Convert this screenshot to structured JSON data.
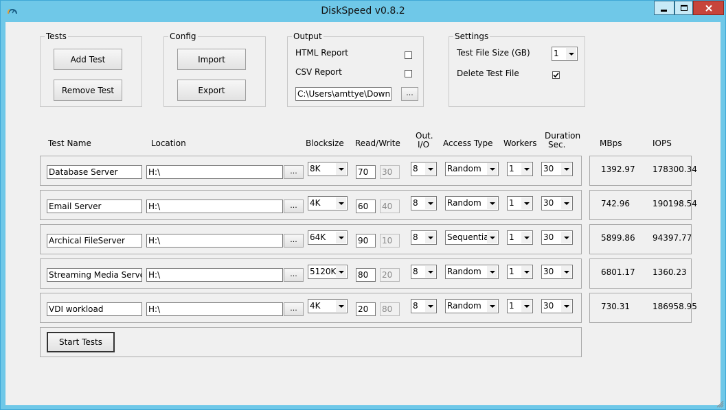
{
  "window": {
    "title": "DiskSpeed v0.8.2"
  },
  "groups": {
    "tests": {
      "legend": "Tests",
      "add_label": "Add Test",
      "remove_label": "Remove Test"
    },
    "config": {
      "legend": "Config",
      "import_label": "Import",
      "export_label": "Export"
    },
    "output": {
      "legend": "Output",
      "html_label": "HTML Report",
      "csv_label": "CSV Report",
      "path": "C:\\Users\\amttye\\Downloads",
      "browse_label": "..."
    },
    "settings": {
      "legend": "Settings",
      "size_label": "Test File Size (GB)",
      "size_value": "1",
      "delete_label": "Delete Test File",
      "delete_checked": true
    }
  },
  "columns": {
    "name": "Test Name",
    "location": "Location",
    "blocksize": "Blocksize",
    "rw": "Read/Write",
    "outio_1": "Out.",
    "outio_2": "I/O",
    "access": "Access Type",
    "workers": "Workers",
    "duration_1": "Duration",
    "duration_2": "Sec.",
    "mbps": "MBps",
    "iops": "IOPS"
  },
  "rows": [
    {
      "name": "Database Server",
      "location": "H:\\",
      "browse": "...",
      "blocksize": "8K",
      "read": "70",
      "write": "30",
      "outio": "8",
      "access": "Random",
      "workers": "1",
      "duration": "30",
      "mbps": "1392.97",
      "iops": "178300.34"
    },
    {
      "name": "Email Server",
      "location": "H:\\",
      "browse": "...",
      "blocksize": "4K",
      "read": "60",
      "write": "40",
      "outio": "8",
      "access": "Random",
      "workers": "1",
      "duration": "30",
      "mbps": "742.96",
      "iops": "190198.54"
    },
    {
      "name": "Archical FileServer",
      "location": "H:\\",
      "browse": "...",
      "blocksize": "64K",
      "read": "90",
      "write": "10",
      "outio": "8",
      "access": "Sequential",
      "workers": "1",
      "duration": "30",
      "mbps": "5899.86",
      "iops": "94397.77"
    },
    {
      "name": "Streaming Media Server",
      "location": "H:\\",
      "browse": "...",
      "blocksize": "5120K",
      "read": "80",
      "write": "20",
      "outio": "8",
      "access": "Random",
      "workers": "1",
      "duration": "30",
      "mbps": "6801.17",
      "iops": "1360.23"
    },
    {
      "name": "VDI workload",
      "location": "H:\\",
      "browse": "...",
      "blocksize": "4K",
      "read": "20",
      "write": "80",
      "outio": "8",
      "access": "Random",
      "workers": "1",
      "duration": "30",
      "mbps": "730.31",
      "iops": "186958.95"
    }
  ],
  "actions": {
    "start_label": "Start Tests"
  },
  "colors": {
    "titlebar": "#6fc8e8",
    "close": "#c7453b",
    "background": "#f0f0f0"
  }
}
